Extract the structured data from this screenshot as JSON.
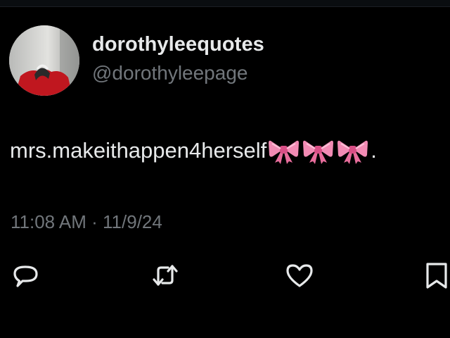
{
  "post": {
    "display_name": "dorothyleequotes",
    "handle": "@dorothyleepage",
    "text": "mrs.makeithappen4herself",
    "emoji": [
      "ribbon-emoji",
      "ribbon-emoji",
      "ribbon-emoji"
    ],
    "text_suffix": ".",
    "timestamp": "11:08 AM · 11/9/24"
  },
  "actions": {
    "reply_icon": "speech-bubble-icon",
    "repost_icon": "repost-arrows-icon",
    "like_icon": "heart-icon",
    "bookmark_icon": "bookmark-icon"
  },
  "colors": {
    "background": "#000000",
    "primary_text": "#e7e9ea",
    "secondary_text": "#71767b",
    "bow": "#f28bb4"
  }
}
